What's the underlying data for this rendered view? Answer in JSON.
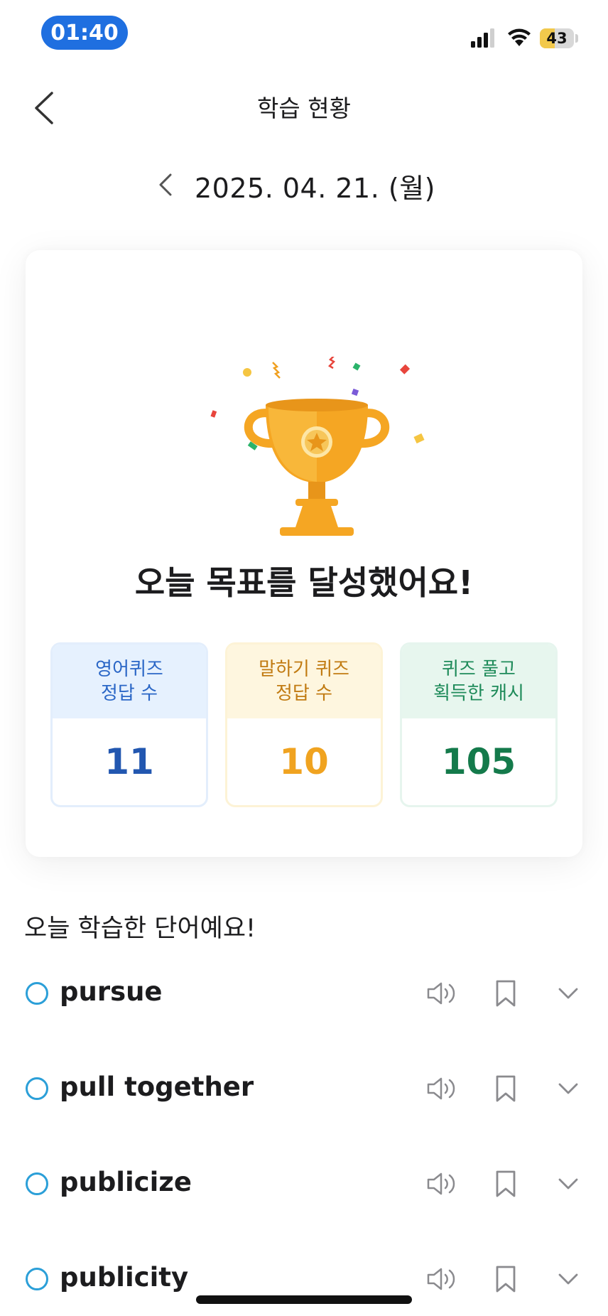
{
  "status": {
    "time": "01:40",
    "battery_level": "43",
    "battery_fraction": 0.43
  },
  "header": {
    "title": "학습 현황",
    "date": "2025. 04. 21. (월)"
  },
  "card": {
    "headline": "오늘 목표를 달성했어요!",
    "stats": [
      {
        "label_line1": "영어퀴즈",
        "label_line2": "정답 수",
        "value": "11"
      },
      {
        "label_line1": "말하기 퀴즈",
        "label_line2": "정답 수",
        "value": "10"
      },
      {
        "label_line1": "퀴즈 풀고",
        "label_line2": "획득한 캐시",
        "value": "105"
      }
    ]
  },
  "words": {
    "title": "오늘 학습한 단어예요!",
    "items": [
      {
        "word": "pursue"
      },
      {
        "word": "pull together"
      },
      {
        "word": "publicize"
      },
      {
        "word": "publicity"
      }
    ]
  },
  "colors": {
    "accent_blue": "#1f6fe0",
    "trophy_gold": "#f5a623",
    "check_blue": "#2b9fd8"
  },
  "icons": [
    "back-chevron-icon",
    "prev-date-chevron-icon",
    "trophy-icon",
    "speaker-icon",
    "bookmark-icon",
    "chevron-down-icon",
    "signal-icon",
    "wifi-icon",
    "battery-icon"
  ]
}
